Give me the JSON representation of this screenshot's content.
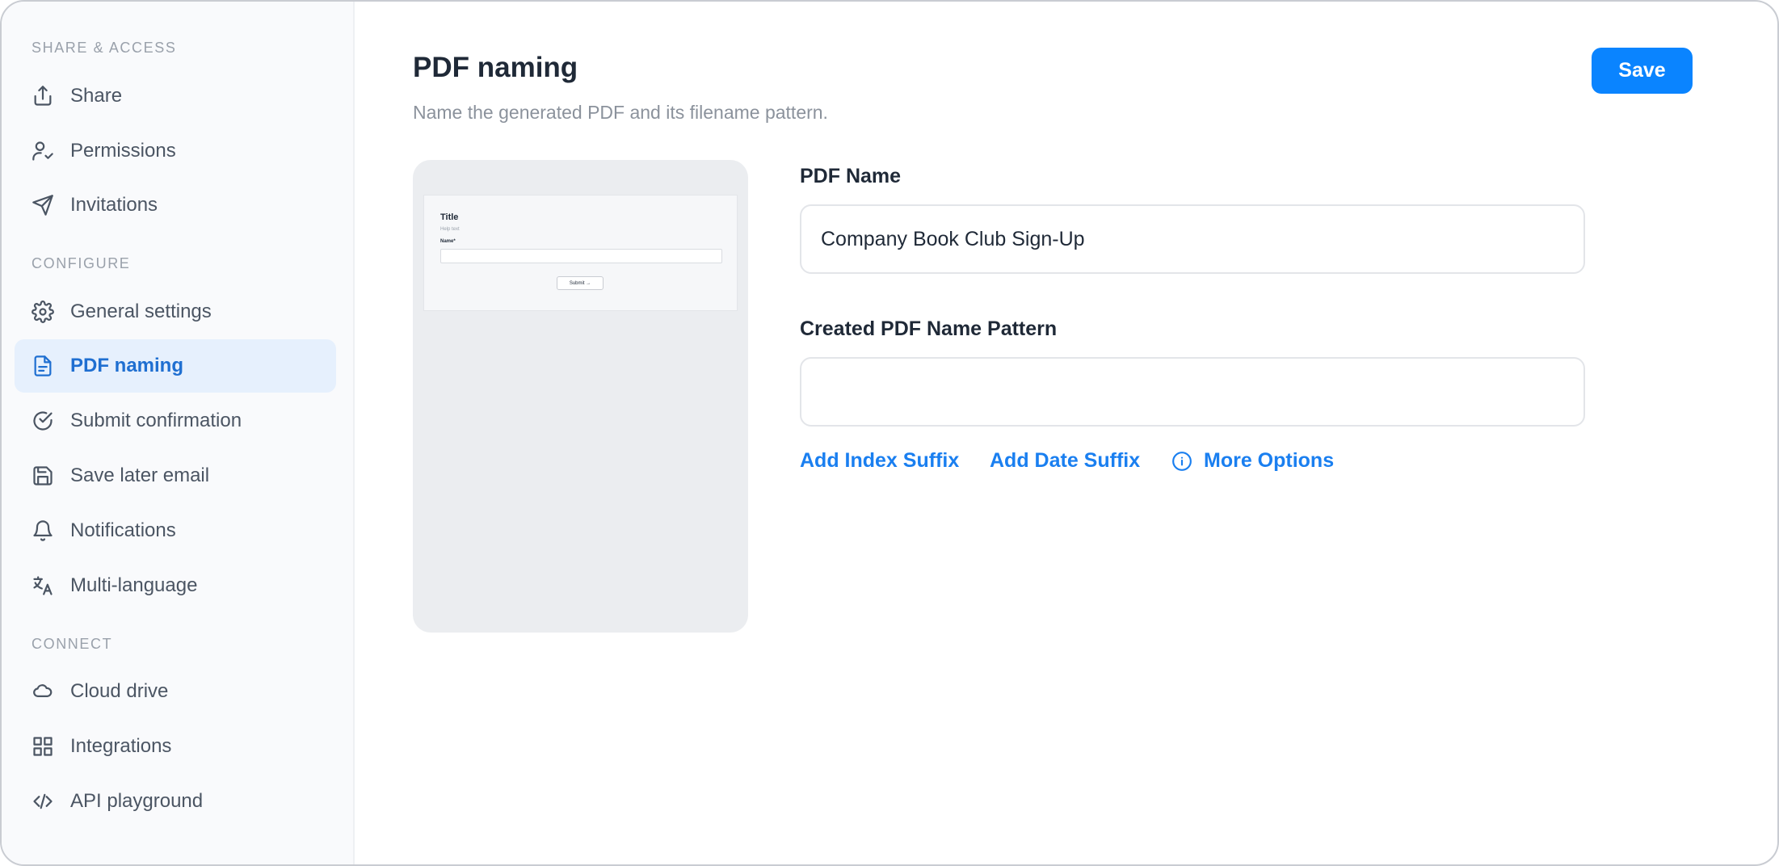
{
  "sidebar": {
    "sections": [
      {
        "label": "SHARE & ACCESS"
      },
      {
        "label": "CONFIGURE"
      },
      {
        "label": "CONNECT"
      }
    ],
    "items": [
      {
        "label": "Share",
        "icon": "share-icon"
      },
      {
        "label": "Permissions",
        "icon": "user-check-icon"
      },
      {
        "label": "Invitations",
        "icon": "send-icon"
      },
      {
        "label": "General settings",
        "icon": "gear-icon"
      },
      {
        "label": "PDF naming",
        "icon": "file-text-icon",
        "active": true
      },
      {
        "label": "Submit confirmation",
        "icon": "check-circle-icon"
      },
      {
        "label": "Save later email",
        "icon": "save-icon"
      },
      {
        "label": "Notifications",
        "icon": "bell-icon"
      },
      {
        "label": "Multi-language",
        "icon": "translate-icon"
      },
      {
        "label": "Cloud drive",
        "icon": "cloud-icon"
      },
      {
        "label": "Integrations",
        "icon": "grid-icon"
      },
      {
        "label": "API playground",
        "icon": "code-icon"
      }
    ]
  },
  "header": {
    "title": "PDF naming",
    "subtitle": "Name the generated PDF and its filename pattern.",
    "save_label": "Save"
  },
  "preview": {
    "title": "Title",
    "help_text": "Help text",
    "field_label": "Name*",
    "submit_label": "Submit →"
  },
  "form": {
    "pdf_name_label": "PDF Name",
    "pdf_name_value": "Company Book Club Sign-Up",
    "pattern_label": "Created PDF Name Pattern",
    "pattern_value": "",
    "links": {
      "index_suffix": "Add Index Suffix",
      "date_suffix": "Add Date Suffix",
      "more_options": "More Options"
    }
  },
  "colors": {
    "accent": "#0a84ff",
    "active_bg": "#e6f0fd",
    "active_text": "#1f6fd1",
    "link": "#1a7ff0"
  }
}
